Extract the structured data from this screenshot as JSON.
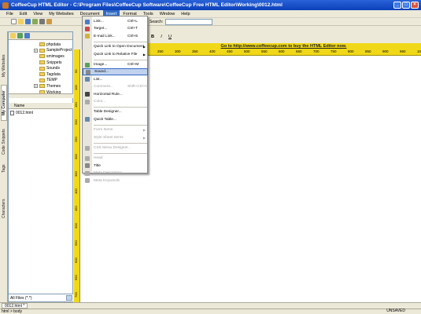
{
  "window": {
    "title": "CoffeeCup HTML Editor - C:\\Program Files\\CoffeeCup Software\\CoffeeCup Free HTML Editor\\Working\\0012.html"
  },
  "menubar": [
    "File",
    "Edit",
    "View",
    "My Websites",
    "Document",
    "Insert",
    "Format",
    "Tools",
    "Window",
    "Help"
  ],
  "left_tabs": [
    "My Websites",
    "My Computer",
    "Code Snippets",
    "Tags",
    "Characters"
  ],
  "tree": [
    {
      "label": "phpdata",
      "expand": false
    },
    {
      "label": "SampleProject",
      "expand": true
    },
    {
      "label": "smimages",
      "expand": false
    },
    {
      "label": "Snippets",
      "expand": false
    },
    {
      "label": "Sounds",
      "expand": false
    },
    {
      "label": "Tagdata",
      "expand": false
    },
    {
      "label": "TEMP",
      "expand": false
    },
    {
      "label": "Themes",
      "expand": true
    },
    {
      "label": "Working",
      "expand": false
    }
  ],
  "file_list": {
    "header": "Name",
    "files": [
      "0012.html"
    ]
  },
  "filter": "All Files (*.*)",
  "search_label": "Search:",
  "format_buttons": [
    "B",
    "I",
    "U"
  ],
  "ad_text": "Go to http://www.coffeecup.com to buy the HTML Editor now.",
  "ruler_h": [
    "250",
    "300",
    "350",
    "400",
    "450",
    "500",
    "550",
    "600",
    "650",
    "700",
    "750",
    "800",
    "850",
    "900",
    "950",
    "1000"
  ],
  "ruler_v": [
    "50",
    "100",
    "150",
    "200",
    "250",
    "300",
    "350",
    "400",
    "450",
    "500",
    "550",
    "600",
    "650",
    "700"
  ],
  "doc_tab": "0012.html *",
  "status": {
    "left": "html > body",
    "right": "UNSAVED"
  },
  "insert_menu": [
    {
      "label": "Link...",
      "shortcut": "Ctrl+L",
      "state": "normal",
      "icon": "link-icon",
      "color": "#4a7cc7"
    },
    {
      "label": "Target...",
      "shortcut": "Ctrl+T",
      "state": "normal",
      "icon": "target-icon",
      "color": "#c74a4a"
    },
    {
      "label": "E-mail Link...",
      "shortcut": "Ctrl+E",
      "state": "normal",
      "icon": "email-icon",
      "color": "#d0b040"
    },
    {
      "sep": true
    },
    {
      "label": "Quick Link to Open Document",
      "submenu": true,
      "state": "normal"
    },
    {
      "label": "Quick Link to Relative File",
      "submenu": true,
      "state": "normal"
    },
    {
      "sep": true
    },
    {
      "label": "Image...",
      "shortcut": "Ctrl+M",
      "state": "normal",
      "icon": "image-icon",
      "color": "#5aa05a"
    },
    {
      "label": "Sound...",
      "state": "highlighted",
      "icon": "sound-icon",
      "color": "#888888"
    },
    {
      "label": "List...",
      "state": "normal",
      "icon": "list-icon",
      "color": "#6688aa"
    },
    {
      "label": "Comment...",
      "shortcut": "Shift+Ctrl+C",
      "state": "disabled"
    },
    {
      "label": "Horizontal Rule...",
      "state": "normal",
      "icon": "rule-icon",
      "color": "#444444"
    },
    {
      "label": "Color...",
      "state": "disabled",
      "icon": "color-icon",
      "color": "#aaaaaa"
    },
    {
      "sep": true
    },
    {
      "label": "Table Designer...",
      "state": "normal"
    },
    {
      "label": "Quick Table...",
      "state": "normal",
      "icon": "table-icon",
      "color": "#6688aa"
    },
    {
      "sep": true
    },
    {
      "label": "Form Items",
      "submenu": true,
      "state": "disabled"
    },
    {
      "label": "Style Sheet Items",
      "submenu": true,
      "state": "disabled"
    },
    {
      "sep": true
    },
    {
      "label": "CSS Menu Designer...",
      "state": "disabled",
      "icon": "css-icon",
      "color": "#aaaaaa"
    },
    {
      "sep": true
    },
    {
      "label": "Head",
      "state": "disabled",
      "icon": "head-icon",
      "color": "#aaaaaa"
    },
    {
      "label": "Title",
      "state": "normal",
      "icon": "title-icon",
      "color": "#888888"
    },
    {
      "label": "Meta Description",
      "state": "disabled",
      "icon": "meta-icon",
      "color": "#aaaaaa"
    },
    {
      "label": "Meta Keywords",
      "state": "disabled",
      "icon": "meta-icon",
      "color": "#aaaaaa"
    }
  ]
}
